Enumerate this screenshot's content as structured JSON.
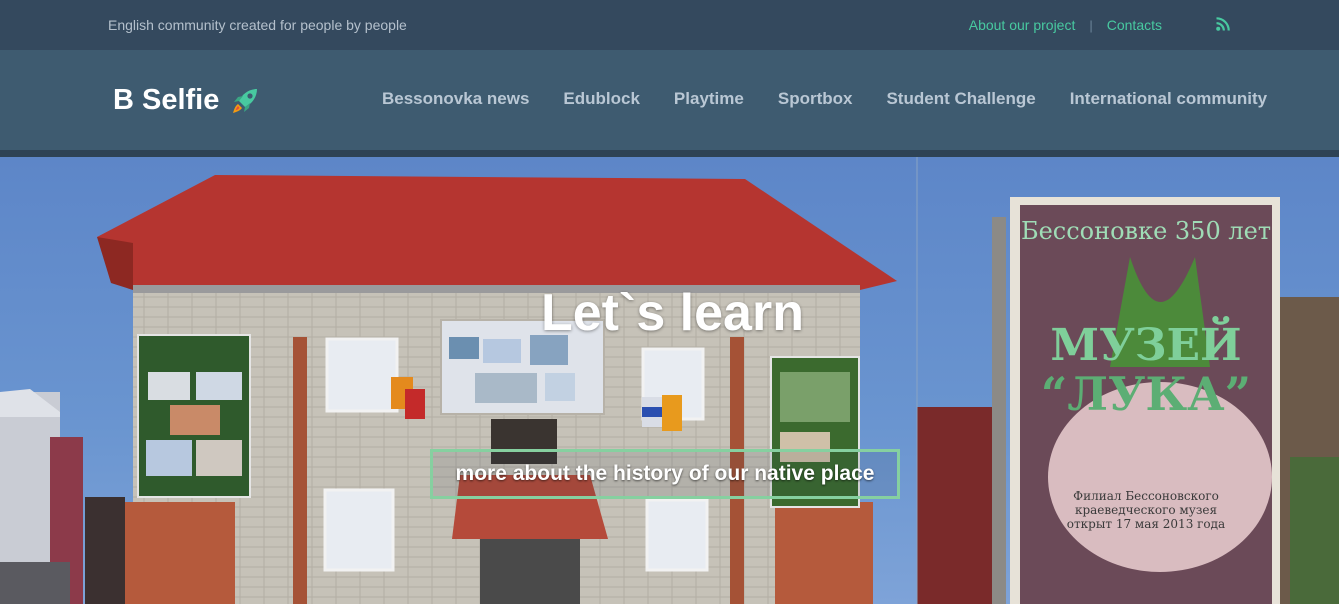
{
  "topbar": {
    "tagline": "English community created for people by people",
    "links": [
      "About our project",
      "Contacts"
    ],
    "rss_icon": "rss-icon"
  },
  "brand": {
    "name": "B Selfie",
    "icon": "rocket-icon"
  },
  "nav": {
    "items": [
      "Bessonovka news",
      "Edublock",
      "Playtime",
      "Sportbox",
      "Student Challenge",
      "International community"
    ]
  },
  "hero": {
    "title": "Let`s learn",
    "button": "more about the history of our native place",
    "sign_lines": [
      "Бессоновке 350 лет",
      "МУЗЕЙ",
      "“ЛУКА”",
      "Филиал Бессоновского",
      "краеведческого музея",
      "открыт 17 мая 2013 года"
    ]
  },
  "colors": {
    "topbar_bg": "#34495e",
    "navbar_bg": "#3e5b70",
    "accent": "#48c9a0",
    "button_border": "#86d0a0"
  }
}
